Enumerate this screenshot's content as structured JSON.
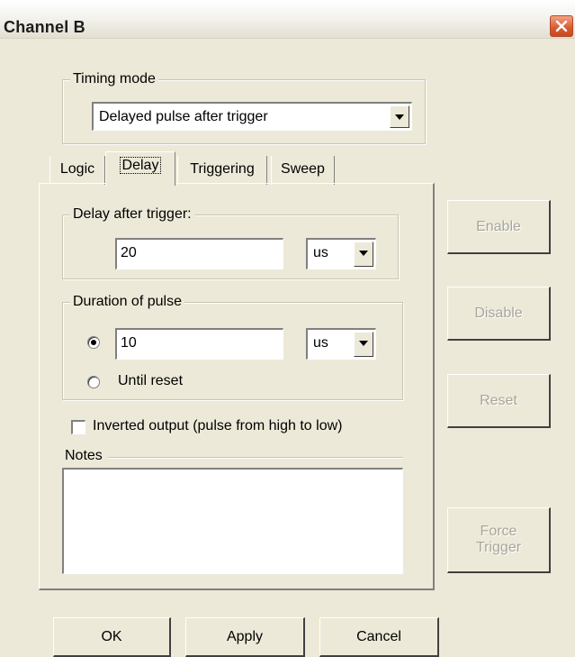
{
  "window": {
    "title": "Channel B"
  },
  "timing_mode": {
    "legend": "Timing mode",
    "selected": "Delayed pulse after trigger"
  },
  "tabs": [
    {
      "label": "Logic"
    },
    {
      "label": "Delay"
    },
    {
      "label": "Triggering"
    },
    {
      "label": "Sweep"
    }
  ],
  "delay_group": {
    "legend": "Delay after trigger:",
    "value": "20",
    "unit": "us"
  },
  "duration_group": {
    "legend": "Duration of pulse",
    "value": "10",
    "unit": "us",
    "until_reset_label": "Until reset"
  },
  "inverted_output": {
    "label": "Inverted output (pulse from high to low)",
    "checked": false
  },
  "notes": {
    "legend": "Notes",
    "value": ""
  },
  "side_buttons": {
    "enable": "Enable",
    "disable": "Disable",
    "reset": "Reset",
    "force_trigger_line1": "Force",
    "force_trigger_line2": "Trigger"
  },
  "footer": {
    "ok": "OK",
    "apply": "Apply",
    "cancel": "Cancel"
  },
  "colors": {
    "face": "#ece9d8",
    "close_button": "#d9592f",
    "disabled_text": "#a8a69a"
  }
}
